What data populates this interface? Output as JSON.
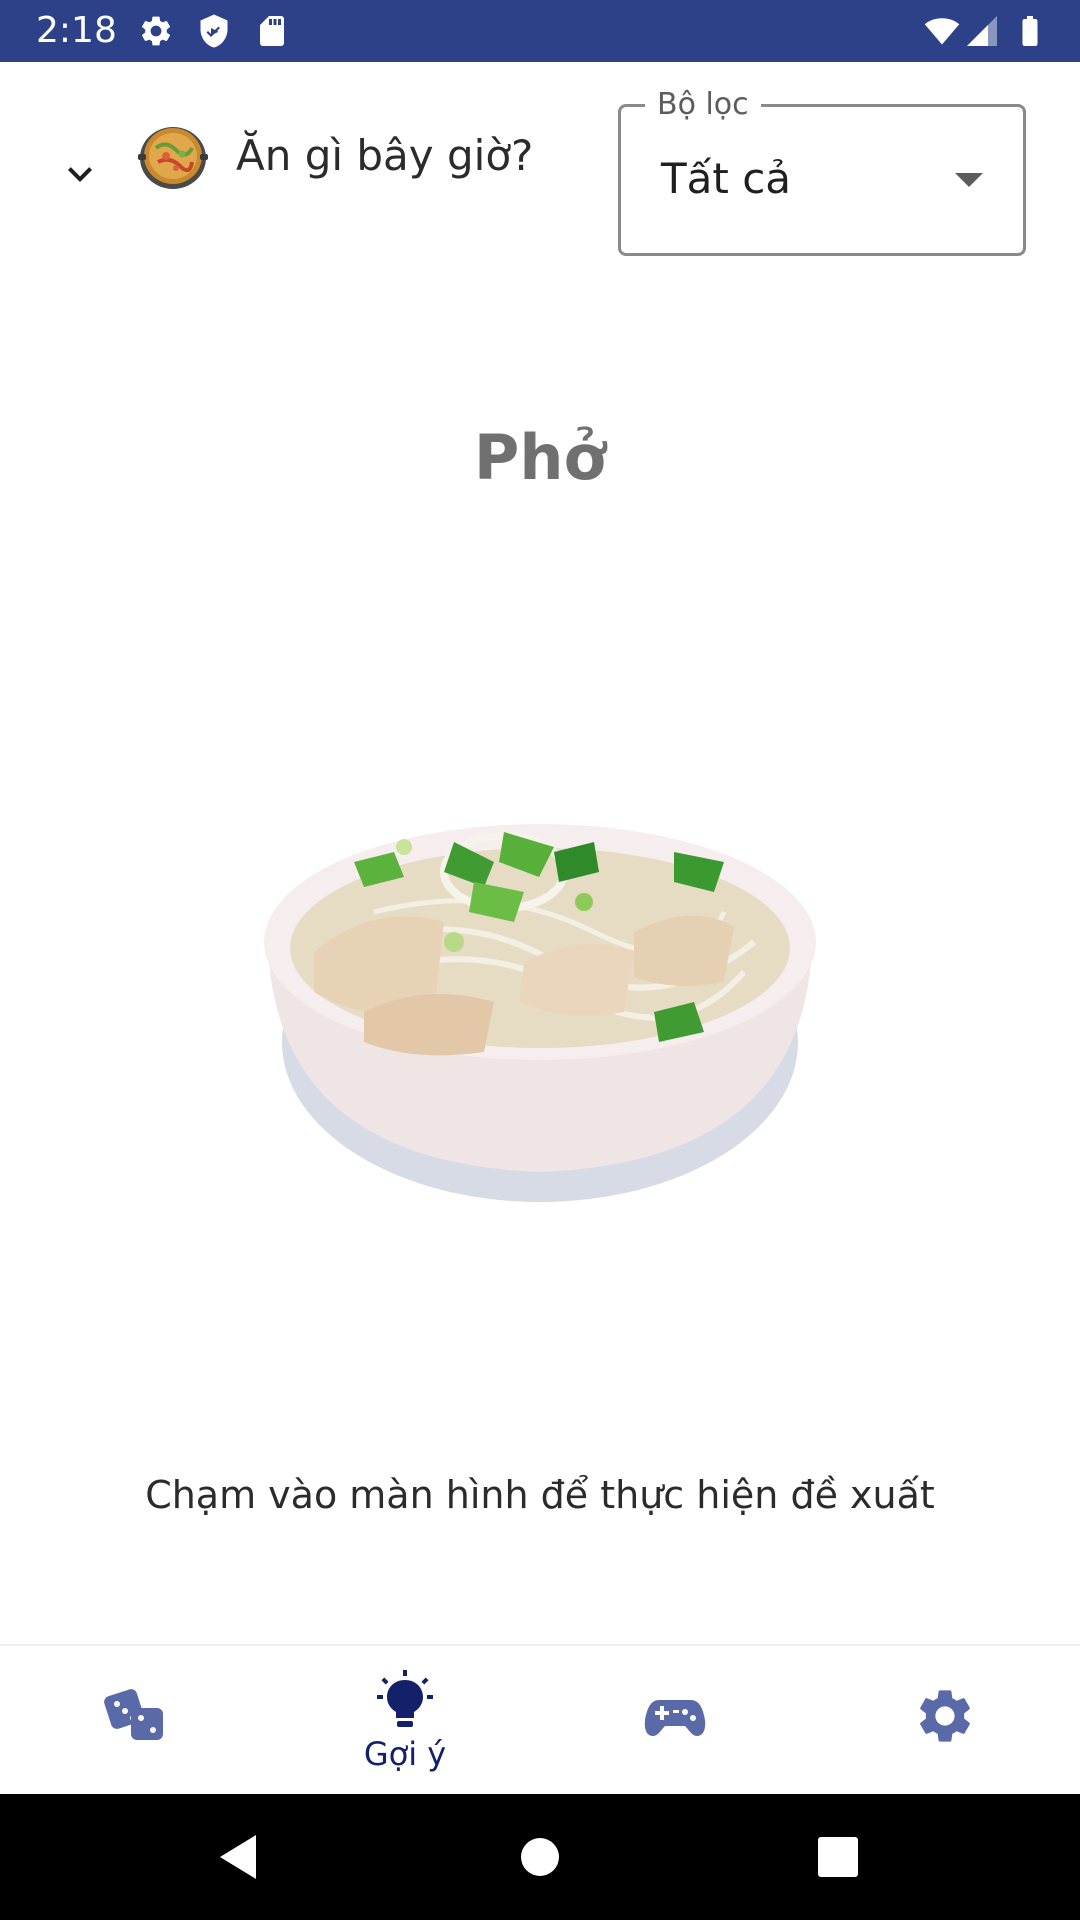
{
  "status_bar": {
    "time": "2:18",
    "icons": [
      "settings-icon",
      "shield-icon",
      "sd-card-icon",
      "wifi-icon",
      "signal-icon",
      "battery-icon"
    ],
    "background": "#2d4189"
  },
  "header": {
    "app_title": "Ăn gì bây giờ?",
    "filter": {
      "label": "Bộ lọc",
      "selected": "Tất cả"
    }
  },
  "main": {
    "food_name": "Phở",
    "hint": "Chạm vào màn hình để thực hiện đề xuất"
  },
  "bottom_nav": {
    "items": [
      {
        "icon": "dice-icon",
        "label": "",
        "active": false
      },
      {
        "icon": "lightbulb-icon",
        "label": "Gợi ý",
        "active": true
      },
      {
        "icon": "gamepad-icon",
        "label": "",
        "active": false
      },
      {
        "icon": "gear-icon",
        "label": "",
        "active": false
      }
    ],
    "active_color": "#13216b",
    "inactive_color": "#5a6aa8"
  },
  "system_nav": {
    "buttons": [
      "back-icon",
      "home-icon",
      "recents-icon"
    ]
  }
}
